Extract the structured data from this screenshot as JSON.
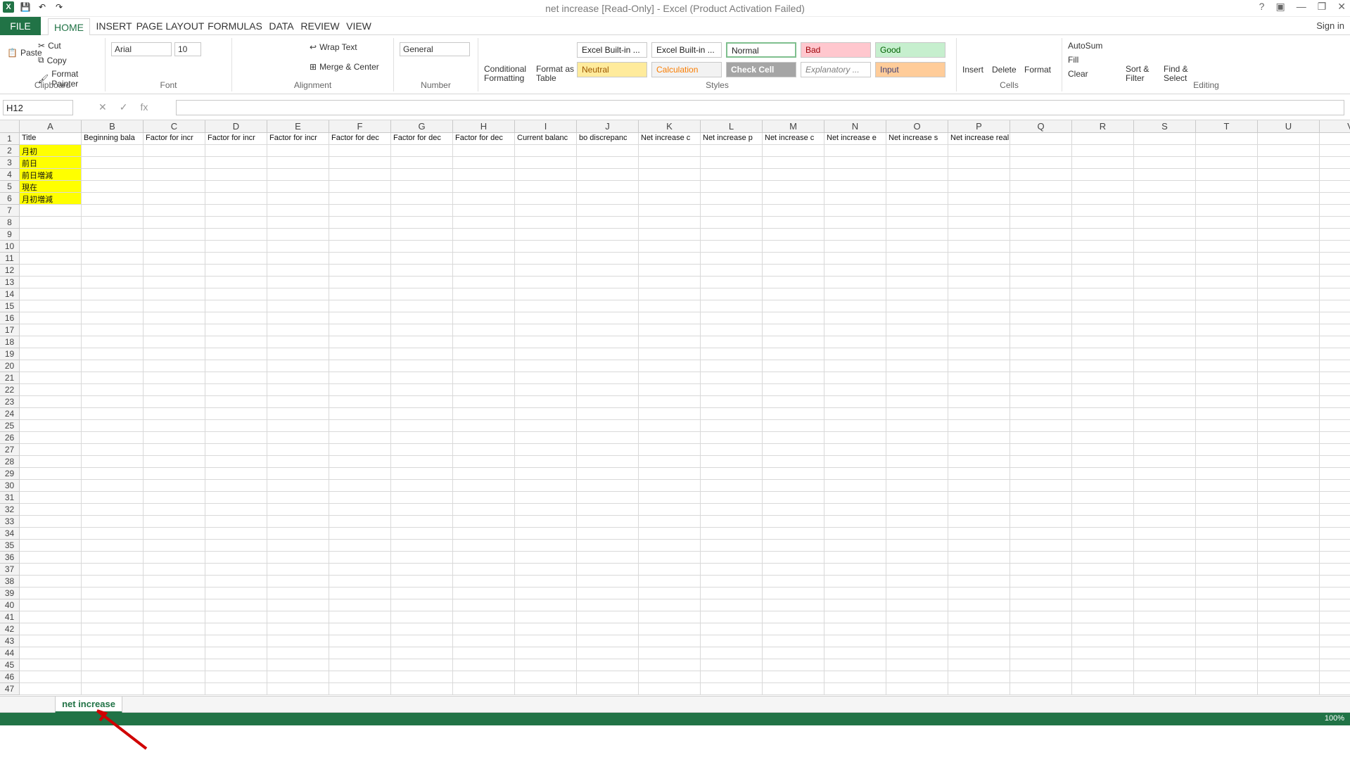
{
  "window": {
    "title": "net increase  [Read-Only] - Excel (Product Activation Failed)",
    "sign_in": "Sign in"
  },
  "tabs": [
    "FILE",
    "HOME",
    "INSERT",
    "PAGE LAYOUT",
    "FORMULAS",
    "DATA",
    "REVIEW",
    "VIEW"
  ],
  "ribbon": {
    "clipboard": {
      "paste": "Paste",
      "cut": "Cut",
      "copy": "Copy",
      "format_painter": "Format Painter",
      "label": "Clipboard"
    },
    "font": {
      "name": "Arial",
      "size": "10",
      "label": "Font"
    },
    "alignment": {
      "wrap_text": "Wrap Text",
      "merge_center": "Merge & Center",
      "label": "Alignment"
    },
    "number": {
      "format": "General",
      "label": "Number"
    },
    "styles": {
      "conditional": "Conditional Formatting",
      "format_table": "Format as Table",
      "label": "Styles",
      "items": [
        "Excel Built-in ...",
        "Excel Built-in ...",
        "Normal",
        "Bad",
        "Good",
        "Neutral",
        "Calculation",
        "Check Cell",
        "Explanatory ...",
        "Input"
      ]
    },
    "cells": {
      "insert": "Insert",
      "delete": "Delete",
      "format": "Format",
      "label": "Cells"
    },
    "editing": {
      "autosum": "AutoSum",
      "fill": "Fill",
      "clear": "Clear",
      "sort": "Sort & Filter",
      "find": "Find & Select",
      "label": "Editing"
    }
  },
  "formula_bar": {
    "name_box": "H12",
    "fx": "fx"
  },
  "sheet": {
    "columns": [
      "A",
      "B",
      "C",
      "D",
      "E",
      "F",
      "G",
      "H",
      "I",
      "J",
      "K",
      "L",
      "M",
      "N",
      "O",
      "P",
      "Q",
      "R",
      "S",
      "T",
      "U",
      "V"
    ],
    "rows": 47,
    "headers": [
      "Title",
      "Beginning bala",
      "Factor for incr",
      "Factor for incr",
      "Factor for incr",
      "Factor for dec",
      "Factor for dec",
      "Factor for dec",
      "Current balanc",
      "bo discrepanc",
      "Net increase c",
      "Net increase p",
      "Net increase c",
      "Net increase e",
      "Net increase s",
      "Net increase real estate and trade"
    ],
    "row_labels": [
      "月初",
      "前日",
      "前日増減",
      "現在",
      "月初増減"
    ]
  },
  "footer": {
    "sheet_tab": "net increase",
    "zoom": "100%"
  }
}
